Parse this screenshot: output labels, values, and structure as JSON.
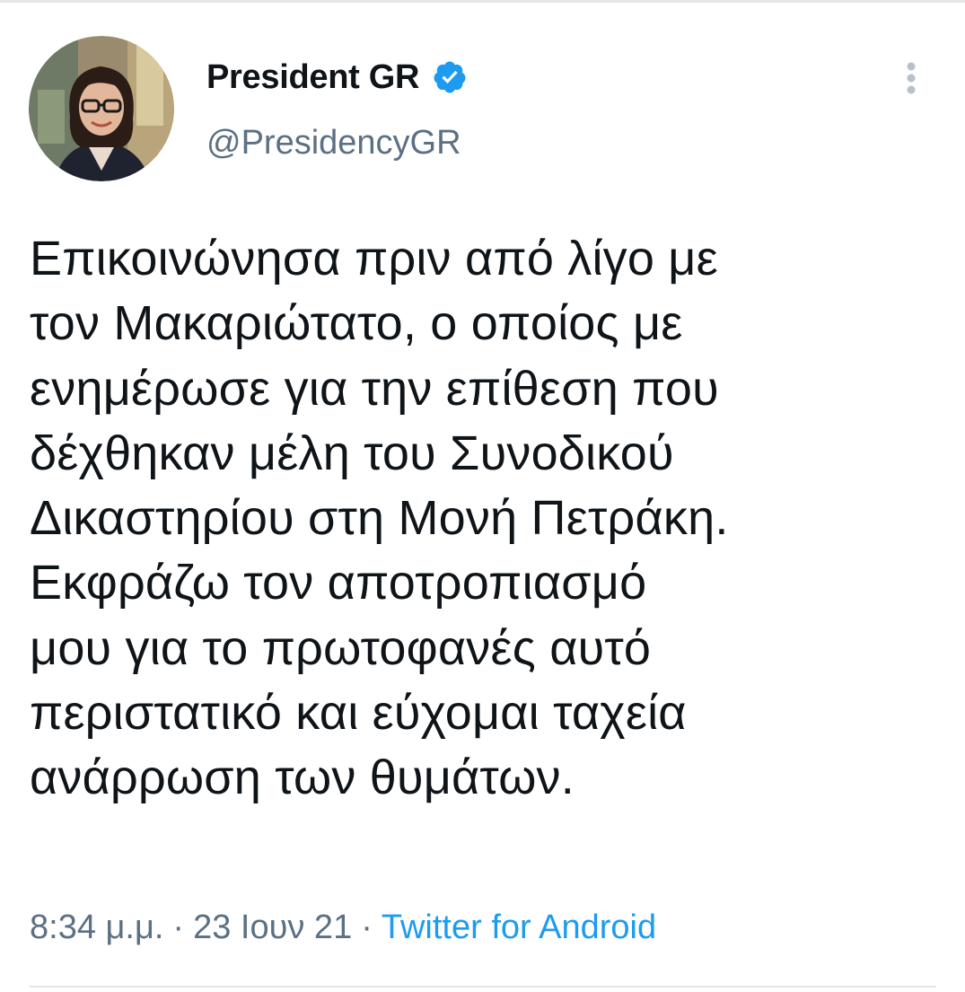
{
  "tweet": {
    "author": {
      "display_name": "President GR",
      "handle": "@PresidencyGR",
      "verified": true,
      "verified_icon": "verified-badge-icon",
      "verified_color": "#1d9bf0"
    },
    "text_lines": [
      "Επικοινώνησα πριν από λίγο με",
      "τον Μακαριώτατο, ο οποίος με",
      "ενημέρωσε για την επίθεση που",
      "δέχθηκαν μέλη του Συνοδικού",
      "Δικαστηρίου στη Μονή Πετράκη.",
      "Εκφράζω τον αποτροπιασμό",
      "μου για το πρωτοφανές αυτό",
      "περιστατικό και εύχομαι ταχεία",
      "ανάρρωση των θυμάτων."
    ],
    "meta": {
      "time": "8:34 μ.μ.",
      "separator": "·",
      "date": "23 Ιουν 21",
      "source": "Twitter for Android"
    },
    "more_icon": "more-vertical-icon",
    "colors": {
      "text": "#0f1419",
      "secondary": "#5b7083",
      "link": "#1d9bf0"
    }
  }
}
